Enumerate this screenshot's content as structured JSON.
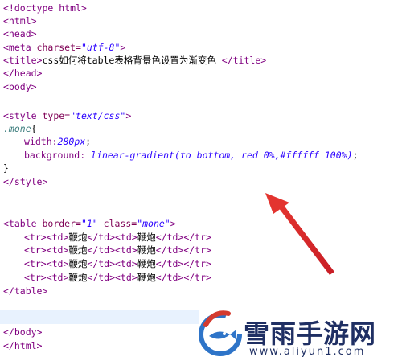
{
  "editor": {
    "lines": {
      "doctype": "<!doctype html>",
      "html_open": "<html>",
      "head_open": "<head>",
      "meta_open": "<meta ",
      "meta_attr": "charset=",
      "meta_val": "\"utf-8\"",
      "meta_close": ">",
      "title_open": "<title>",
      "title_text": "css如何将table表格背景色设置为渐变色 ",
      "title_close": "</title>",
      "head_close": "</head>",
      "body_open": "<body>",
      "style_open": "<style ",
      "style_attr": "type=",
      "style_val": "\"text/css\"",
      "style_close_bracket": ">",
      "selector": ".mone",
      "brace_open": "{",
      "width_prop": "width:",
      "width_val": "280px",
      "width_end": ";",
      "bg_prop": "background: ",
      "bg_val": "linear-gradient(to bottom, red 0%,#ffffff 100%)",
      "bg_end": ";",
      "brace_close": "}",
      "style_end": "</style>",
      "table_open": "<table ",
      "table_attr1": "border=",
      "table_val1": "\"1\"",
      "table_attr2": " class=",
      "table_val2": "\"mone\"",
      "table_close_bracket": ">",
      "row_open": "<tr><td>",
      "cell_text": "鞭炮",
      "cell_mid": "</td><td>",
      "row_close": "</td></tr>",
      "table_end": "</table>",
      "body_close": "</body>",
      "html_close": "</html>"
    }
  },
  "watermark": {
    "title": "雪雨手游网",
    "url": "www.aliyun1.com"
  },
  "colors": {
    "tag": "#800080",
    "attribute": "#7f0055",
    "string": "#2a00ff",
    "arrow": "#e3342f",
    "watermark": "#1f2f63"
  }
}
